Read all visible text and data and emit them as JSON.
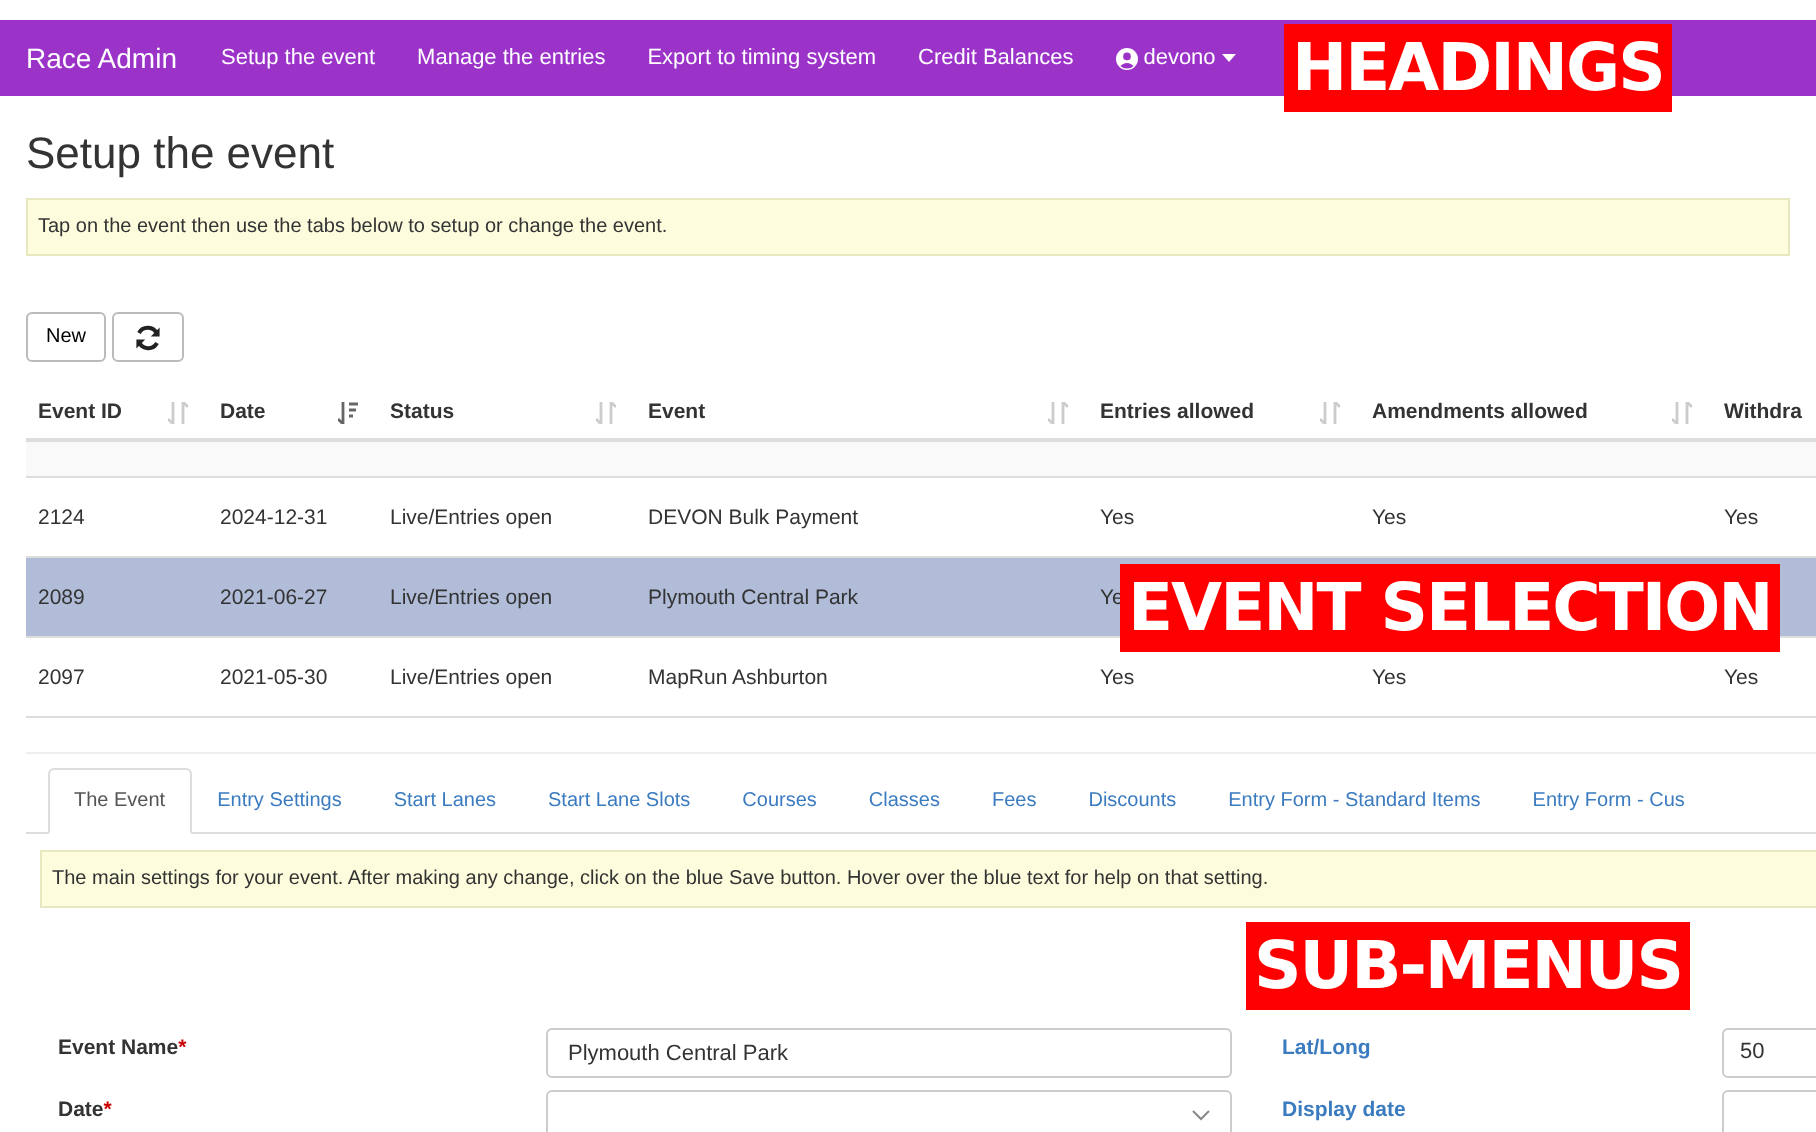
{
  "navbar": {
    "brand": "Race Admin",
    "links": [
      {
        "label": "Setup the event"
      },
      {
        "label": "Manage the entries"
      },
      {
        "label": "Export to timing system"
      },
      {
        "label": "Credit Balances"
      }
    ],
    "user": "devono"
  },
  "page_title": "Setup the event",
  "intro": "Tap on the event then use the tabs below to setup or change the event.",
  "toolbar": {
    "new_button": "New"
  },
  "table": {
    "columns": [
      {
        "label": "Event ID",
        "sorted": false
      },
      {
        "label": "Date",
        "sorted": true
      },
      {
        "label": "Status",
        "sorted": false
      },
      {
        "label": "Event",
        "sorted": false
      },
      {
        "label": "Entries allowed",
        "sorted": false
      },
      {
        "label": "Amendments allowed",
        "sorted": false
      },
      {
        "label": "Withdra"
      }
    ],
    "rows": [
      {
        "cells": [
          "2124",
          "2024-12-31",
          "Live/Entries open",
          "DEVON Bulk Payment",
          "Yes",
          "Yes",
          "Yes"
        ],
        "selected": false
      },
      {
        "cells": [
          "2089",
          "2021-06-27",
          "Live/Entries open",
          "Plymouth Central Park",
          "Ye"
        ],
        "selected": true
      },
      {
        "cells": [
          "2097",
          "2021-05-30",
          "Live/Entries open",
          "MapRun Ashburton",
          "Yes",
          "Yes",
          "Yes"
        ],
        "selected": false
      }
    ]
  },
  "tabs": [
    {
      "label": "The Event",
      "selected": true
    },
    {
      "label": "Entry Settings",
      "selected": false
    },
    {
      "label": "Start Lanes",
      "selected": false
    },
    {
      "label": "Start Lane Slots",
      "selected": false
    },
    {
      "label": "Courses",
      "selected": false
    },
    {
      "label": "Classes",
      "selected": false
    },
    {
      "label": "Fees",
      "selected": false
    },
    {
      "label": "Discounts",
      "selected": false
    },
    {
      "label": "Entry Form - Standard Items",
      "selected": false
    },
    {
      "label": "Entry Form - Cus",
      "selected": false
    }
  ],
  "tab_help": "The main settings for your event. After making any change, click on the blue Save button. Hover over the blue text for help on that setting.",
  "form": [
    {
      "label": "Event Name",
      "required": "*",
      "value": "Plymouth Central Park",
      "kind": "text",
      "side_label": "Lat/Long",
      "side_value": "50"
    },
    {
      "label": "Date",
      "required": "*",
      "kind": "select",
      "side_label": "Display date"
    }
  ],
  "annotations": [
    {
      "text": "HEADINGS"
    },
    {
      "text": "EVENT SELECTION"
    },
    {
      "text": "SUB-MENUS"
    }
  ]
}
